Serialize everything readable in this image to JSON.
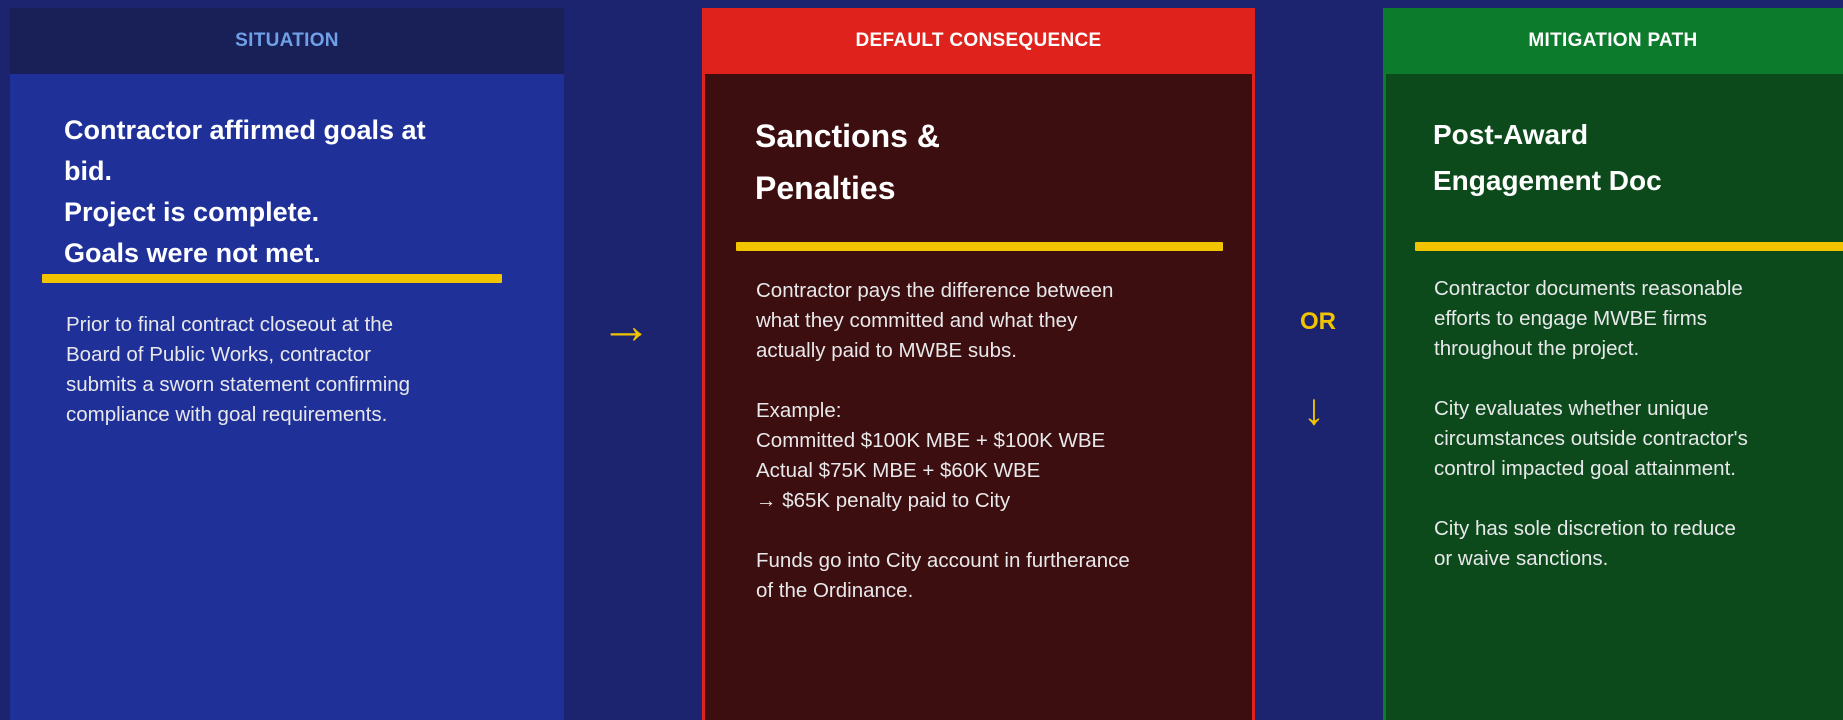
{
  "situation": {
    "header": "SITUATION",
    "title_lines": [
      "Contractor affirmed goals at",
      "bid.",
      "Project is complete.",
      "Goals were not met."
    ],
    "paragraphs": [
      [
        "Prior to final contract closeout at the",
        "Board of Public Works, contractor",
        "submits a sworn statement confirming",
        "compliance with goal requirements."
      ]
    ]
  },
  "connectors": {
    "arrow_right": "→",
    "or_label": "OR",
    "arrow_down": "↓"
  },
  "default_consequence": {
    "header": "DEFAULT CONSEQUENCE",
    "title_lines": [
      "Sanctions &",
      "Penalties"
    ],
    "paragraphs": [
      [
        "Contractor pays the difference between",
        "what they committed and what they",
        "actually paid to MWBE subs."
      ],
      [
        "Example:",
        "Committed $100K MBE + $100K WBE",
        "Actual $75K MBE + $60K WBE",
        "→ $65K penalty paid to City"
      ],
      [
        "Funds go into City account in furtherance",
        "of the Ordinance."
      ]
    ]
  },
  "mitigation_path": {
    "header": "MITIGATION PATH",
    "title_lines": [
      "Post-Award",
      "Engagement Doc"
    ],
    "paragraphs": [
      [
        "Contractor documents reasonable",
        "efforts to engage MWBE firms",
        "throughout the project."
      ],
      [
        "City evaluates whether unique",
        "circumstances outside contractor's",
        "control impacted goal attainment."
      ],
      [
        "City has sole discretion to reduce",
        "or waive sanctions."
      ]
    ]
  },
  "colors": {
    "background": "#1c2470",
    "situation_panel": "#1f3199",
    "default_panel": "#3c0e0f",
    "default_accent": "#e0221c",
    "mitigation_panel": "#0c4a1c",
    "mitigation_accent": "#0d7b2c",
    "highlight_rule": "#f2c400"
  }
}
